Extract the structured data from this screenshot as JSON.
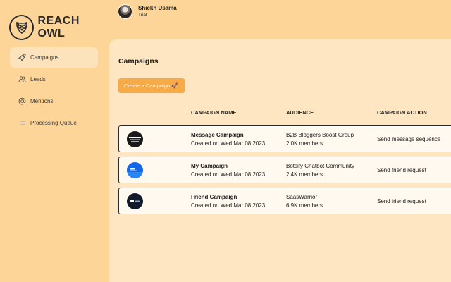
{
  "app": {
    "logo_text": "REACH OWL"
  },
  "user": {
    "name": "Shiekh Usama",
    "plan": "Trial"
  },
  "sidebar": {
    "items": [
      {
        "label": "Campaigns",
        "icon": "rocket-icon",
        "active": true
      },
      {
        "label": "Leads",
        "icon": "users-icon"
      },
      {
        "label": "Mentions",
        "icon": "at-sign-icon"
      },
      {
        "label": "Processing Queue",
        "icon": "list-icon"
      }
    ]
  },
  "main": {
    "title": "Campaigns",
    "create_button": "Create a Campaign 🚀",
    "columns": [
      "CAMPAIGN NAME",
      "AUDIENCE",
      "CAMPAIGN ACTION"
    ],
    "rows": [
      {
        "name": "Message Campaign",
        "created": "Created on Wed Mar 08 2023",
        "audience": "B2B Bloggers Boost Group",
        "members": "2.0K members",
        "action": "Send message sequence"
      },
      {
        "name": "My Campaign",
        "created": "Created on Wed Mar 08 2023",
        "audience": "Botsify Chatbot Community",
        "members": "2.4K members",
        "action": "Send friend request"
      },
      {
        "name": "Friend Campaign",
        "created": "Created on Wed Mar 08 2023",
        "audience": "SaasWarrior",
        "members": "6.9K members",
        "action": "Send friend request"
      }
    ]
  },
  "colors": {
    "accent": "#f7aa48",
    "background": "#fdd598",
    "panel": "#fee6c2"
  }
}
